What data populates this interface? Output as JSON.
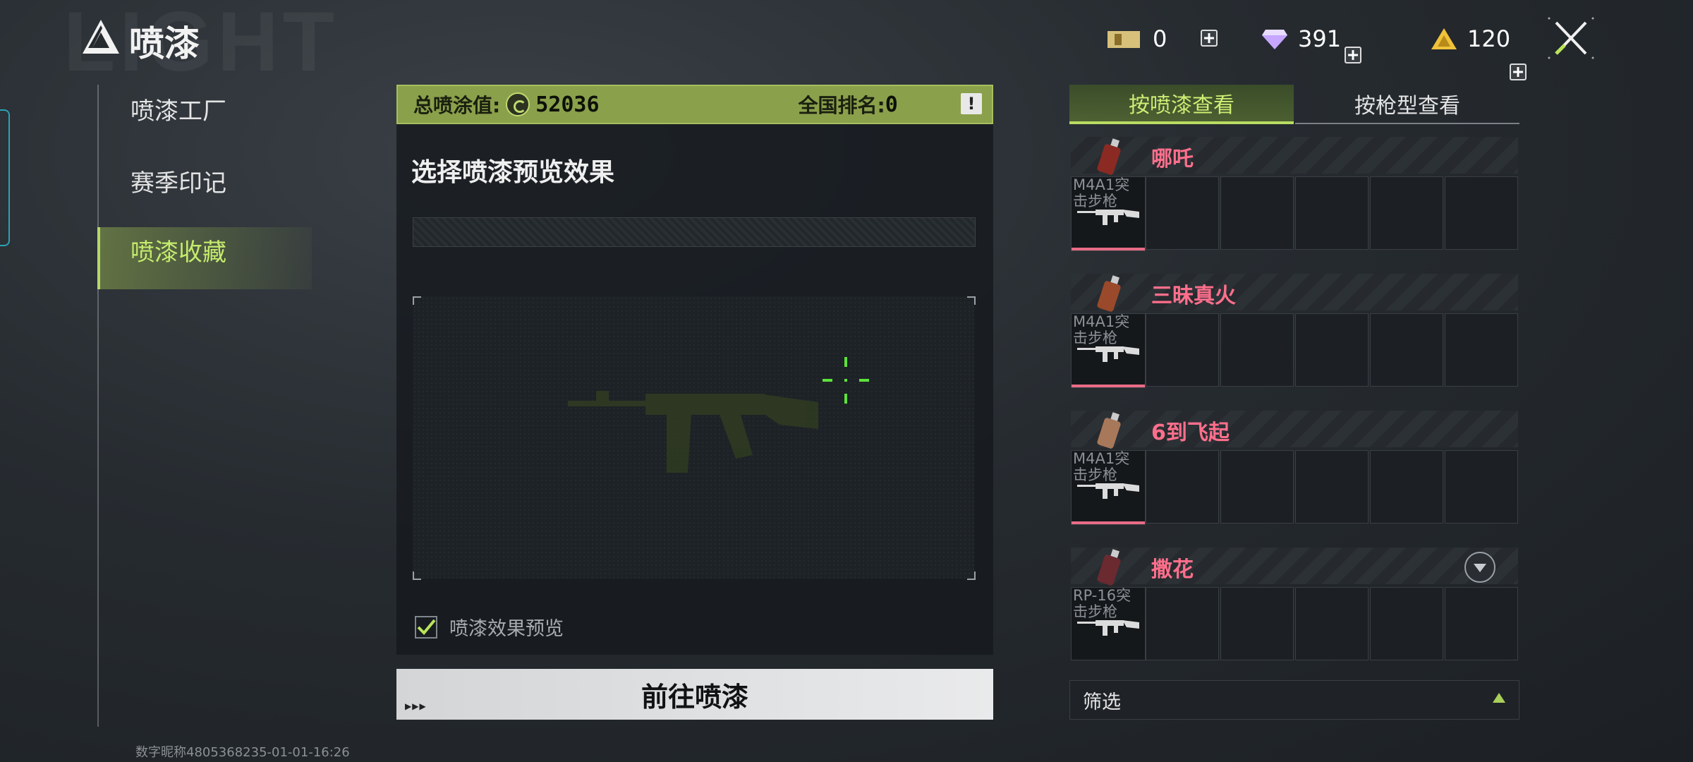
{
  "header": {
    "title": "喷漆",
    "watermark": "LIGHT",
    "currencies": [
      {
        "icon": "ticket-icon",
        "value": "0"
      },
      {
        "icon": "diamond-icon",
        "value": "391"
      },
      {
        "icon": "gold-triangle-icon",
        "value": "120"
      }
    ]
  },
  "sidebar": {
    "items": [
      {
        "label": "喷漆工厂",
        "active": false
      },
      {
        "label": "赛季印记",
        "active": false
      },
      {
        "label": "喷漆收藏",
        "active": true
      }
    ],
    "accent_color": "#c5ec6d"
  },
  "stats": {
    "total_label": "总喷涂值:",
    "total_value": "52036",
    "rank_label": "全国排名:",
    "rank_value": "0",
    "info_label": "!"
  },
  "preview": {
    "title": "选择喷漆预览效果",
    "checkbox_label": "喷漆效果预览",
    "checkbox_checked": true,
    "go_button": "前往喷漆"
  },
  "right_panel": {
    "tabs": [
      {
        "label": "按喷漆查看",
        "active": true
      },
      {
        "label": "按枪型查看",
        "active": false
      }
    ],
    "groups": [
      {
        "name": "哪吒",
        "weapon": "M4A1突击步枪",
        "can_color": "#8a2a22"
      },
      {
        "name": "三昧真火",
        "weapon": "M4A1突击步枪",
        "can_color": "#9a4a2a"
      },
      {
        "name": "6到飞起",
        "weapon": "M4A1突击步枪",
        "can_color": "#a8785a"
      },
      {
        "name": "撒花",
        "weapon": "RP-16突击步枪",
        "can_color": "#6a2a30"
      }
    ],
    "name_color": "#ff6f8c",
    "filter_label": "筛选"
  },
  "footer": {
    "user_id": "数字昵称4805368235-01-01-16:26"
  }
}
